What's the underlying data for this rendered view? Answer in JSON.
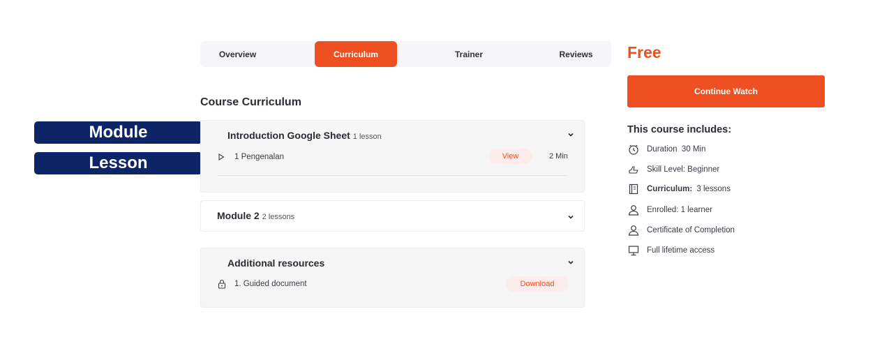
{
  "annotations": {
    "module": "Module",
    "lesson": "Lesson"
  },
  "tabs": [
    {
      "label": "Overview",
      "active": false
    },
    {
      "label": "Curriculum",
      "active": true
    },
    {
      "label": "Trainer",
      "active": false
    },
    {
      "label": "Reviews",
      "active": false
    }
  ],
  "curriculum": {
    "title": "Course Curriculum",
    "modules": [
      {
        "title": "Introduction Google Sheet",
        "count": "1  lesson",
        "expanded": true,
        "items": [
          {
            "icon": "play-icon",
            "title": "1 Pengenalan",
            "action": "View",
            "duration": "2 Min"
          }
        ]
      },
      {
        "title": "Module 2",
        "count": "2 lessons",
        "expanded": false,
        "items": []
      },
      {
        "title": "Additional resources",
        "count": "",
        "expanded": true,
        "items": [
          {
            "icon": "lock-icon",
            "title": "1. Guided document",
            "action": "Download"
          }
        ]
      }
    ]
  },
  "sidebar": {
    "price": "Free",
    "button": "Continue Watch",
    "includes_title": "This course includes:",
    "includes": [
      {
        "icon": "clock-icon",
        "label": "Duration",
        "value": "30 Min"
      },
      {
        "icon": "hand-icon",
        "label": "Skill Level: Beginner",
        "value": ""
      },
      {
        "icon": "book-icon",
        "label": "Curriculum:",
        "value": "3 lessons"
      },
      {
        "icon": "user-icon",
        "label": "Enrolled: 1 learner",
        "value": ""
      },
      {
        "icon": "certificate-icon",
        "label": "Certificate of Completion",
        "value": ""
      },
      {
        "icon": "screen-icon",
        "label": "Full lifetime access",
        "value": ""
      }
    ]
  },
  "colors": {
    "accent": "#ee5022",
    "annotation_bg": "#0d2467",
    "pill_bg": "#fdecec"
  }
}
